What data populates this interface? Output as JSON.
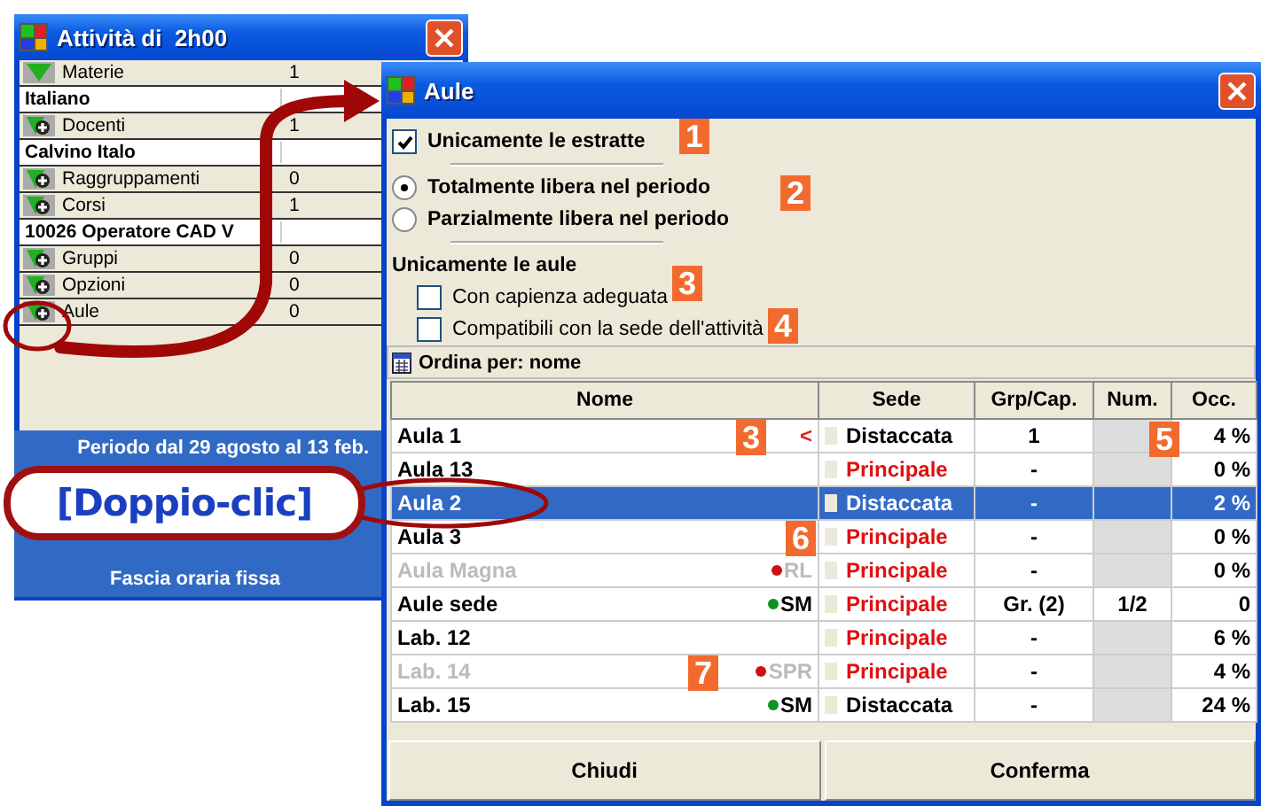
{
  "back_window": {
    "title": "Attività di  2h00",
    "rows": [
      {
        "kind": "group",
        "label": "Materie",
        "count": "1",
        "expanded": true
      },
      {
        "kind": "item",
        "label": "Italiano"
      },
      {
        "kind": "group",
        "label": "Docenti",
        "count": "1",
        "expanded": false
      },
      {
        "kind": "item",
        "label": "Calvino Italo"
      },
      {
        "kind": "group",
        "label": "Raggruppamenti",
        "count": "0",
        "expanded": false
      },
      {
        "kind": "group",
        "label": "Corsi",
        "count": "1",
        "expanded": false
      },
      {
        "kind": "item",
        "label": "10026 Operatore CAD V"
      },
      {
        "kind": "group",
        "label": "Gruppi",
        "count": "0",
        "expanded": false
      },
      {
        "kind": "group",
        "label": "Opzioni",
        "count": "0",
        "expanded": false
      },
      {
        "kind": "group",
        "label": "Aule",
        "count": "0",
        "expanded": false
      }
    ],
    "period": "Periodo dal 29 agosto al 13 feb.",
    "footer": "Fascia oraria fissa"
  },
  "window": {
    "title": "Aule"
  },
  "options": [
    {
      "kind": "checkbox",
      "label": "Unicamente le estratte",
      "checked": true
    },
    {
      "kind": "separator"
    },
    {
      "kind": "radio",
      "label": "Totalmente libera nel periodo",
      "selected": true
    },
    {
      "kind": "radio",
      "label": "Parzialmente libera nel periodo",
      "selected": false
    },
    {
      "kind": "separator"
    },
    {
      "kind": "heading",
      "label": "Unicamente le aule"
    },
    {
      "kind": "checkbox",
      "label": "Con capienza adeguata",
      "checked": false,
      "indented": true
    },
    {
      "kind": "checkbox",
      "label": "Compatibili con la sede dell'attività",
      "checked": false,
      "indented": true
    }
  ],
  "sort_bar": "Ordina per: nome",
  "table": {
    "columns": [
      "Nome",
      "Sede",
      "Grp/Cap.",
      "Num.",
      "Occ."
    ],
    "rows": [
      {
        "name": "Aula 1",
        "disabled": false,
        "mark": "<",
        "sede": "Distaccata",
        "main_site": false,
        "grp": "1",
        "occ": "4 %",
        "selected": false
      },
      {
        "name": "Aula 13",
        "disabled": false,
        "sede": "Principale",
        "main_site": true,
        "grp": "-",
        "occ": "0 %",
        "selected": false
      },
      {
        "name": "Aula 2",
        "disabled": false,
        "sede": "Distaccata",
        "main_site": false,
        "grp": "-",
        "occ": "2 %",
        "selected": true
      },
      {
        "name": "Aula 3",
        "disabled": false,
        "sede": "Principale",
        "main_site": true,
        "grp": "-",
        "occ": "0 %",
        "selected": false
      },
      {
        "name": "Aula Magna",
        "disabled": true,
        "tag": "RL",
        "color": "#d01010",
        "sede": "Principale",
        "main_site": true,
        "grp": "-",
        "occ": "0 %",
        "selected": false
      },
      {
        "name": "Aule sede",
        "disabled": false,
        "tag": "SM",
        "color": "#109020",
        "sede": "Principale",
        "main_site": true,
        "grp": "Gr. (2)",
        "num": "1/2",
        "occ": "0",
        "selected": false
      },
      {
        "name": "Lab. 12",
        "disabled": false,
        "sede": "Principale",
        "main_site": true,
        "grp": "-",
        "occ": "6 %",
        "selected": false
      },
      {
        "name": "Lab. 14",
        "disabled": true,
        "tag": "SPR",
        "color": "#d01010",
        "sede": "Principale",
        "main_site": true,
        "grp": "-",
        "occ": "4 %",
        "selected": false
      },
      {
        "name": "Lab. 15",
        "disabled": false,
        "tag": "SM",
        "color": "#109020",
        "sede": "Distaccata",
        "main_site": false,
        "grp": "-",
        "occ": "24 %",
        "selected": false
      }
    ]
  },
  "buttons": [
    "Chiudi",
    "Conferma"
  ],
  "annotations": [
    {
      "label": "1"
    },
    {
      "label": "2"
    },
    {
      "label": "3"
    },
    {
      "label": "4"
    },
    {
      "label": "3"
    },
    {
      "label": "5"
    },
    {
      "label": "6"
    },
    {
      "label": "7"
    }
  ],
  "callout": "[Doppio-clic]"
}
